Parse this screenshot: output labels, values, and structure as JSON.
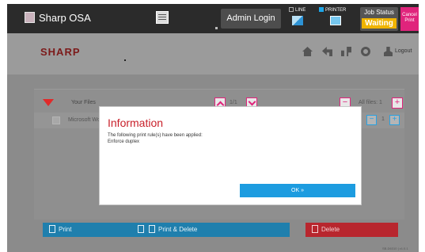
{
  "topbar": {
    "app_title": "Sharp OSA",
    "admin_login": "Admin Login",
    "line_label": "LINE",
    "printer_label": "PRINTER",
    "job_status_label": "Job Status",
    "job_status_value": "Waiting",
    "cancel_line1": "Cancel",
    "cancel_line2": "Print",
    "colors": {
      "cancel": "#e0247c",
      "printer": "#1ea6e8",
      "waiting": "#f0b400"
    }
  },
  "header": {
    "logo": "SHARP",
    "logout": "Logout",
    "icons": [
      "home-icon",
      "back-icon",
      "swap-icon",
      "settings-icon",
      "logout-icon"
    ]
  },
  "files": {
    "your_files": "Your Files",
    "page_indicator": "1/1",
    "all_files": "All files: 1",
    "minus": "−",
    "plus": "+",
    "items": [
      {
        "name": "Microsoft Word",
        "copies": "1"
      }
    ]
  },
  "actions": {
    "print": "Print",
    "print_delete": "Print & Delete",
    "delete": "Delete"
  },
  "version": "SB-D6310 | v1.0.1",
  "modal": {
    "title": "Information",
    "message": "The following print rule(s) have been applied:",
    "rule": "Enforce duplex",
    "ok": "OK »"
  }
}
